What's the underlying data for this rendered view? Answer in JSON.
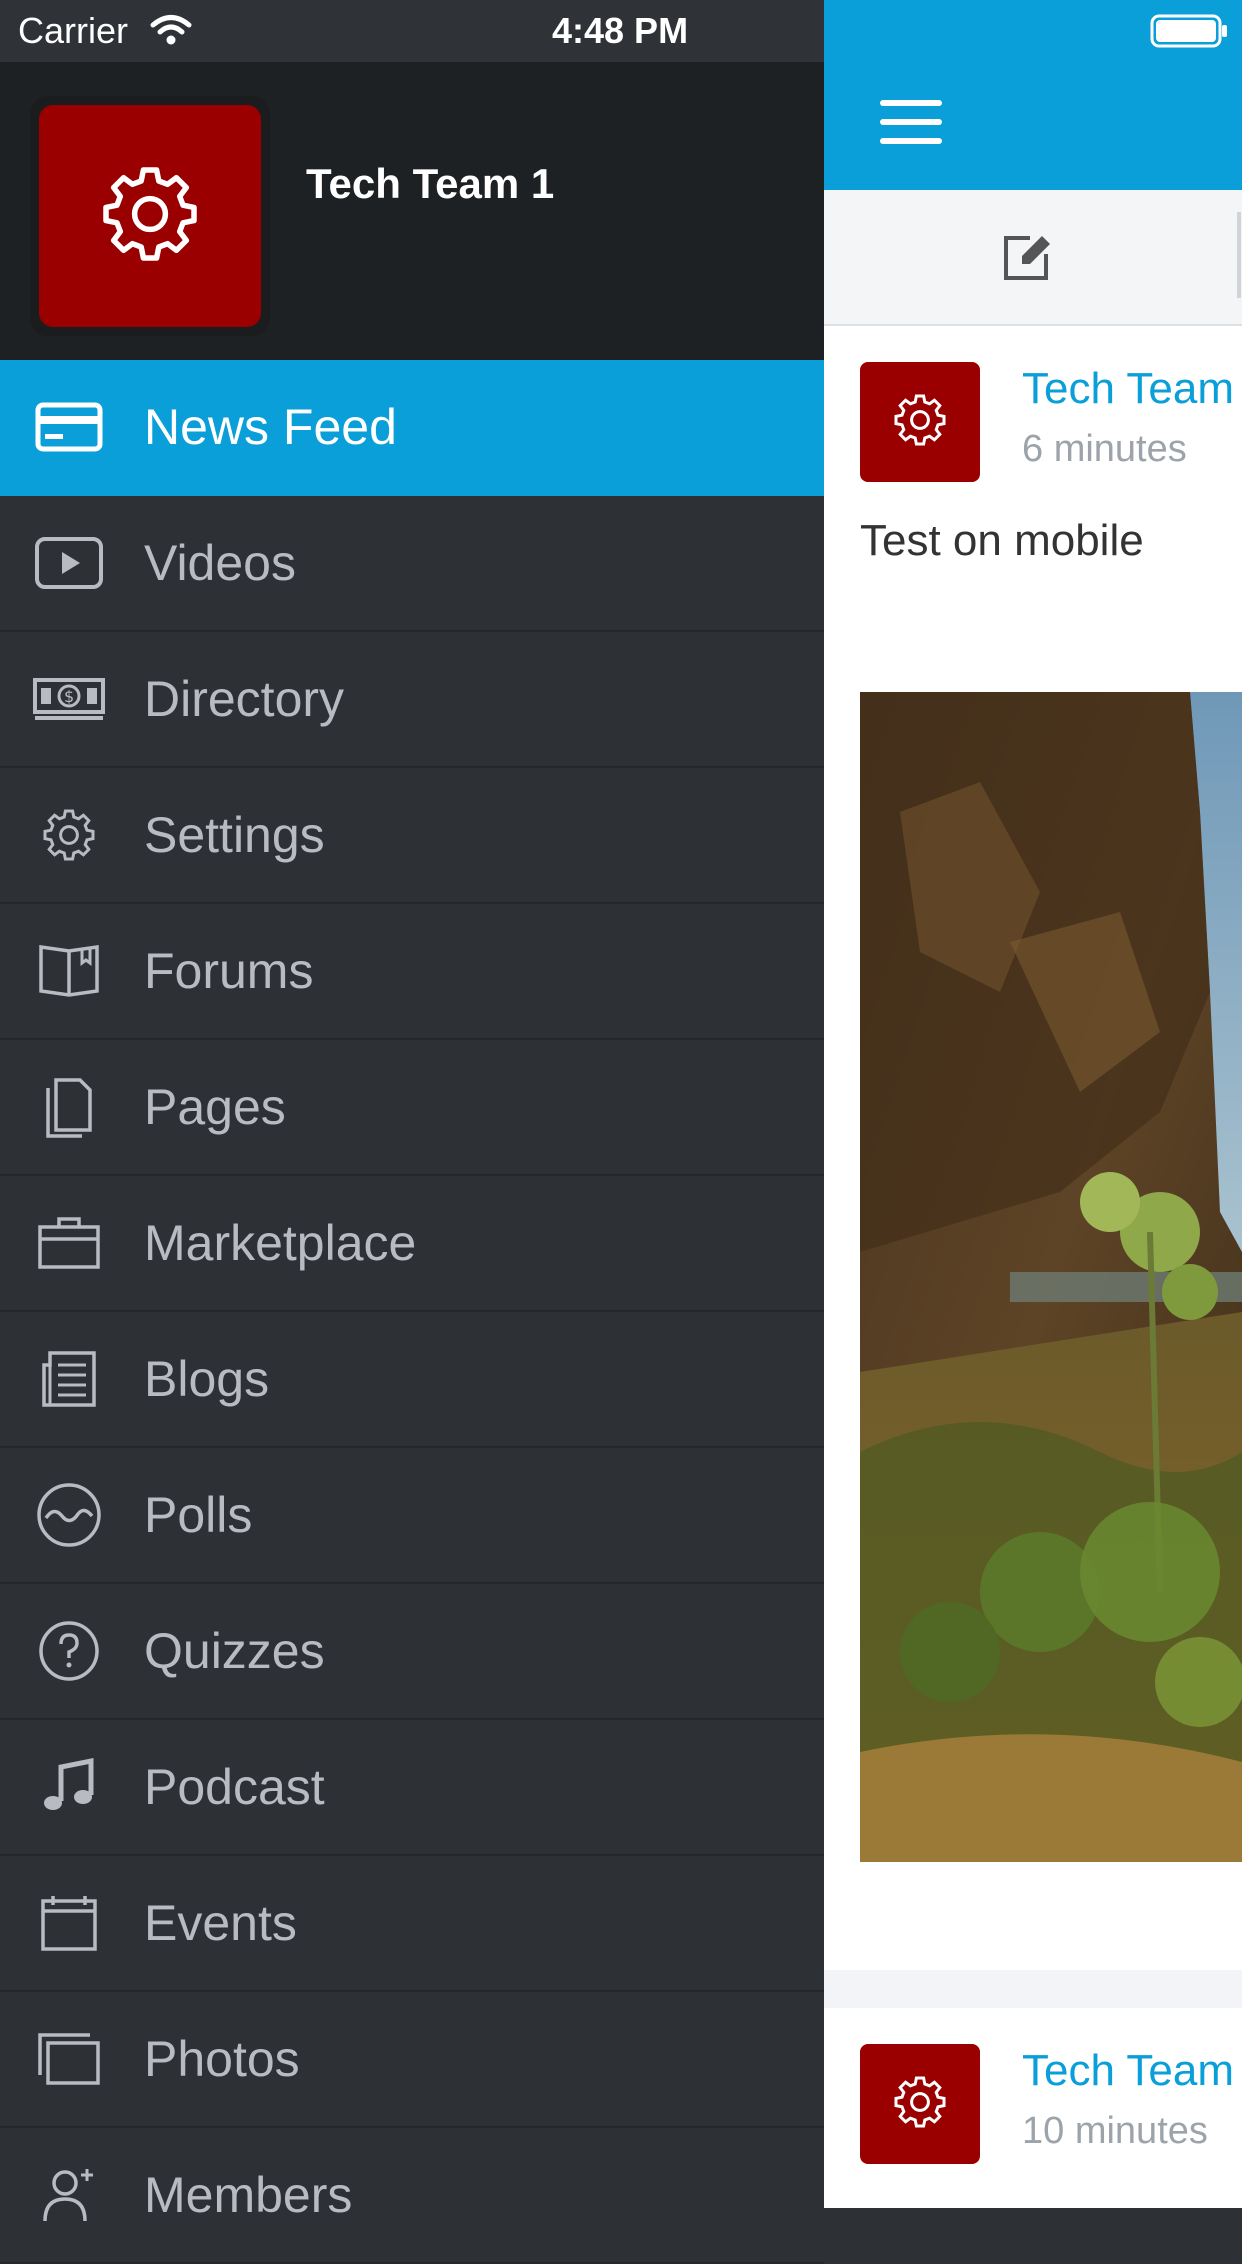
{
  "status_bar": {
    "carrier": "Carrier",
    "time": "4:48 PM"
  },
  "drawer": {
    "profile": {
      "name": "Tech Team 1",
      "avatar_icon": "gear-icon",
      "avatar_color": "#9a0000"
    },
    "menu": [
      {
        "label": "News Feed",
        "icon": "card-icon",
        "active": true
      },
      {
        "label": "Videos",
        "icon": "play-icon",
        "active": false
      },
      {
        "label": "Directory",
        "icon": "money-icon",
        "active": false
      },
      {
        "label": "Settings",
        "icon": "gear-icon",
        "active": false
      },
      {
        "label": "Forums",
        "icon": "book-icon",
        "active": false
      },
      {
        "label": "Pages",
        "icon": "document-icon",
        "active": false
      },
      {
        "label": "Marketplace",
        "icon": "briefcase-icon",
        "active": false
      },
      {
        "label": "Blogs",
        "icon": "newspaper-icon",
        "active": false
      },
      {
        "label": "Polls",
        "icon": "wave-icon",
        "active": false
      },
      {
        "label": "Quizzes",
        "icon": "question-icon",
        "active": false
      },
      {
        "label": "Podcast",
        "icon": "music-note-icon",
        "active": false
      },
      {
        "label": "Events",
        "icon": "calendar-icon",
        "active": false
      },
      {
        "label": "Photos",
        "icon": "photos-icon",
        "active": false
      },
      {
        "label": "Members",
        "icon": "user-add-icon",
        "active": false
      }
    ]
  },
  "main": {
    "posts": [
      {
        "author": "Tech Team",
        "time": "6 minutes",
        "text": "Test on mobile"
      },
      {
        "author": "Tech Team",
        "time": "10 minutes"
      }
    ]
  },
  "colors": {
    "accent": "#0a9fd8",
    "drawer_bg": "#2d3035",
    "drawer_header_bg": "#1e2124",
    "brand_red": "#9a0000"
  }
}
